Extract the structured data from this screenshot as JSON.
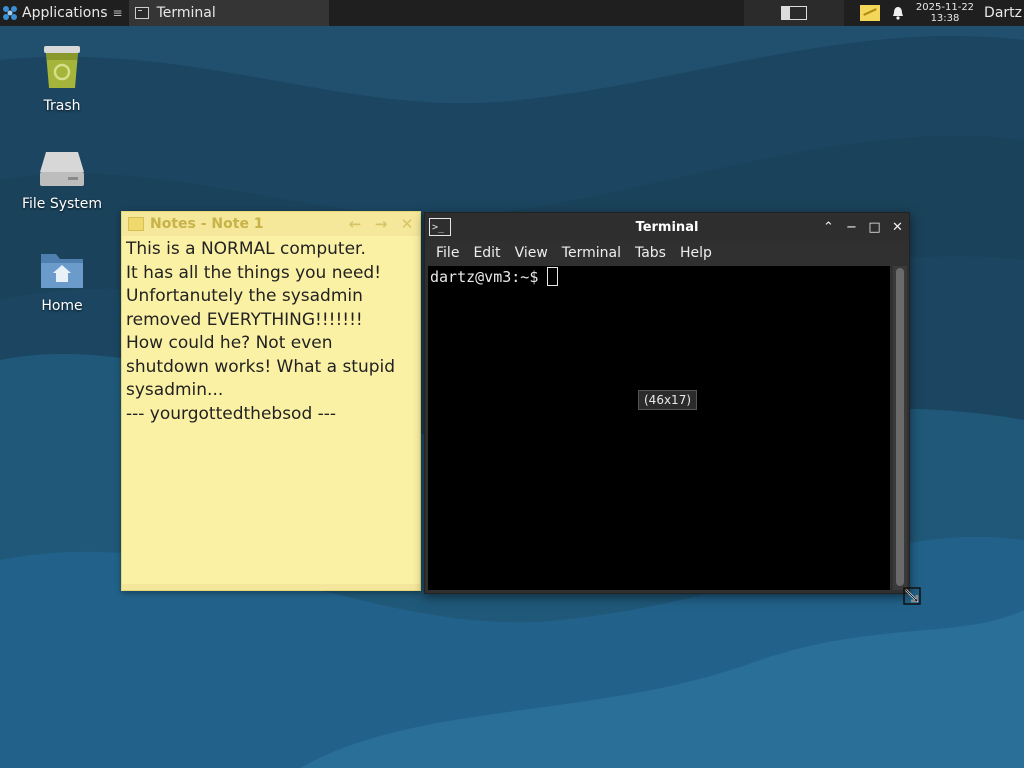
{
  "panel": {
    "apps_label": "Applications",
    "apps_suffix": "≡",
    "task_label": "Terminal",
    "clock_date": "2025-11-22",
    "clock_time": "13:38",
    "user": "Dartz"
  },
  "desktop": {
    "icons": [
      {
        "label": "Trash"
      },
      {
        "label": "File System"
      },
      {
        "label": "Home"
      }
    ]
  },
  "notes": {
    "title": "Notes - Note 1",
    "prev": "←",
    "next": "→",
    "close": "✕",
    "body": "This is a NORMAL computer.\nIt has all the things you need!\nUnfortanutely the sysadmin\nremoved EVERYTHING!!!!!!!\nHow could he? Not even\nshutdown works! What a stupid\nsysadmin...\n--- yourgottedthebsod ---"
  },
  "terminal": {
    "title": "Terminal",
    "menu": [
      "File",
      "Edit",
      "View",
      "Terminal",
      "Tabs",
      "Help"
    ],
    "prompt": "dartz@vm3:~$",
    "size_tooltip": "(46x17)",
    "ctrl_shade": "⌃",
    "ctrl_min": "−",
    "ctrl_max": "□",
    "ctrl_close": "✕"
  },
  "colors": {
    "wallpaper": "#1d4a66",
    "panel": "#1f1f1f",
    "note_bg": "#fbf1a4",
    "terminal_bg": "#000000"
  }
}
